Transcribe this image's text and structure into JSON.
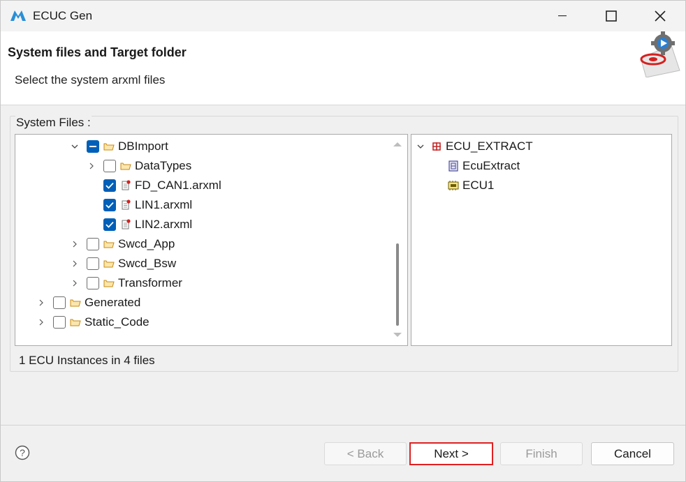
{
  "window": {
    "title": "ECUC Gen"
  },
  "header": {
    "title": "System files and Target folder",
    "description": "Select the system arxml files"
  },
  "system_files": {
    "label": "System Files :",
    "tree": [
      {
        "label": "DBImport",
        "expander": "expanded",
        "check": "partial",
        "icon": "folder-icon"
      },
      {
        "label": "DataTypes",
        "expander": "collapsed",
        "check": "unchecked",
        "icon": "folder-icon"
      },
      {
        "label": "FD_CAN1.arxml",
        "expander": "none",
        "check": "checked",
        "icon": "arxml-file-icon"
      },
      {
        "label": "LIN1.arxml",
        "expander": "none",
        "check": "checked",
        "icon": "arxml-file-icon"
      },
      {
        "label": "LIN2.arxml",
        "expander": "none",
        "check": "checked",
        "icon": "arxml-file-icon"
      },
      {
        "label": "Swcd_App",
        "expander": "collapsed",
        "check": "unchecked",
        "icon": "folder-icon"
      },
      {
        "label": "Swcd_Bsw",
        "expander": "collapsed",
        "check": "unchecked",
        "icon": "folder-icon"
      },
      {
        "label": "Transformer",
        "expander": "collapsed",
        "check": "unchecked",
        "icon": "folder-icon"
      },
      {
        "label": "Generated",
        "expander": "collapsed",
        "check": "unchecked",
        "icon": "folder-icon"
      },
      {
        "label": "Static_Code",
        "expander": "collapsed",
        "check": "unchecked",
        "icon": "folder-icon"
      }
    ]
  },
  "ecu_tree": [
    {
      "label": "ECU_EXTRACT",
      "expander": "expanded",
      "icon": "ecu-extract-package-icon"
    },
    {
      "label": "EcuExtract",
      "expander": "none",
      "icon": "ecu-extract-icon"
    },
    {
      "label": "ECU1",
      "expander": "none",
      "icon": "ecu-instance-icon"
    }
  ],
  "status": {
    "text": "1 ECU Instances in 4 files"
  },
  "buttons": {
    "back": "< Back",
    "next": "Next >",
    "finish": "Finish",
    "cancel": "Cancel"
  },
  "colors": {
    "accent": "#005fb8",
    "focus_outline": "#e02020",
    "folder": "#e8a623"
  }
}
